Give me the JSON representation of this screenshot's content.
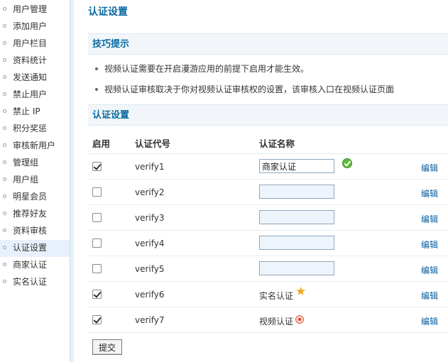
{
  "sidebar": {
    "items": [
      {
        "label": "用户管理"
      },
      {
        "label": "添加用户"
      },
      {
        "label": "用户栏目"
      },
      {
        "label": "资料统计"
      },
      {
        "label": "发送通知"
      },
      {
        "label": "禁止用户"
      },
      {
        "label": "禁止 IP"
      },
      {
        "label": "积分奖惩"
      },
      {
        "label": "审核新用户"
      },
      {
        "label": "管理组"
      },
      {
        "label": "用户组"
      },
      {
        "label": "明星会员"
      },
      {
        "label": "推荐好友"
      },
      {
        "label": "资料审核"
      },
      {
        "label": "认证设置",
        "active": true
      },
      {
        "label": "商家认证"
      },
      {
        "label": "实名认证"
      }
    ]
  },
  "page": {
    "title": "认证设置"
  },
  "tips": {
    "title": "技巧提示",
    "items": [
      "视频认证需要在开启漫游应用的前提下启用才能生效。",
      "视频认证审核取决于你对视频认证审核权的设置，该审核入口在视频认证页面"
    ]
  },
  "settings": {
    "title": "认证设置",
    "headers": {
      "enable": "启用",
      "code": "认证代号",
      "name": "认证名称"
    },
    "rows": [
      {
        "enabled": true,
        "code": "verify1",
        "name_input": "商家认证",
        "name_text": "",
        "icon": "check-icon",
        "edit": "编辑"
      },
      {
        "enabled": false,
        "code": "verify2",
        "name_input": "",
        "name_text": "",
        "icon": "",
        "edit": "编辑"
      },
      {
        "enabled": false,
        "code": "verify3",
        "name_input": "",
        "name_text": "",
        "icon": "",
        "edit": "编辑"
      },
      {
        "enabled": false,
        "code": "verify4",
        "name_input": "",
        "name_text": "",
        "icon": "",
        "edit": "编辑"
      },
      {
        "enabled": false,
        "code": "verify5",
        "name_input": "",
        "name_text": "",
        "icon": "",
        "edit": "编辑"
      },
      {
        "enabled": true,
        "code": "verify6",
        "name_input": null,
        "name_text": "实名认证",
        "icon": "star-icon",
        "edit": "编辑"
      },
      {
        "enabled": true,
        "code": "verify7",
        "name_input": null,
        "name_text": "视频认证",
        "icon": "video-icon",
        "edit": "编辑"
      }
    ],
    "submit_label": "提交"
  },
  "colors": {
    "accent": "#0a6aa1",
    "link": "#0a5fa0",
    "section_bg": "#f2f6fa",
    "active_nav_bg": "#e8f1fb"
  }
}
